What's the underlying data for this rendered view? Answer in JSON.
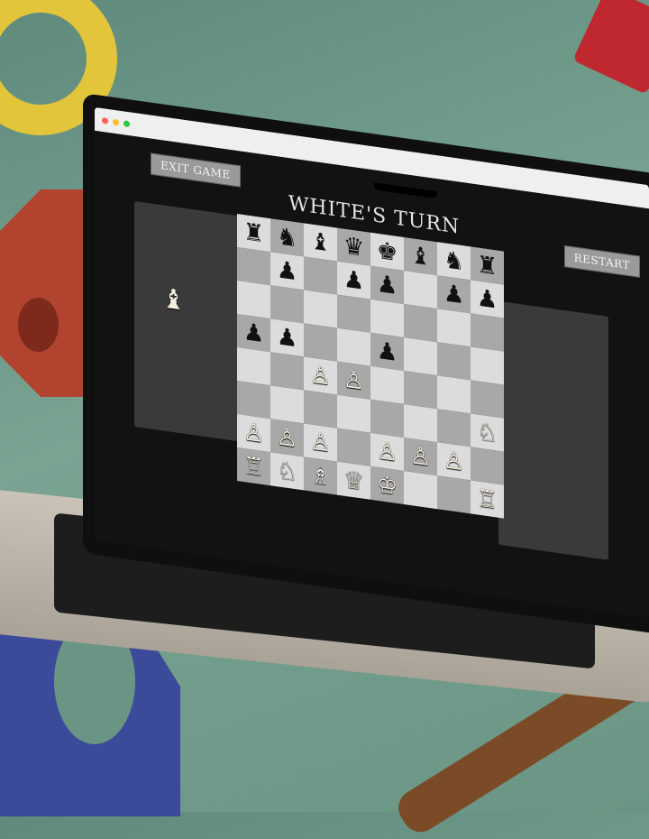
{
  "window": {
    "exit_label": "EXIT GAME",
    "restart_label": "RESTART",
    "turn_text": "WHITE'S TURN"
  },
  "captured_white": [
    "♝"
  ],
  "board": [
    [
      "♜",
      "♞",
      "♝",
      "♛",
      "♚",
      "♝",
      "♞",
      "♜"
    ],
    [
      "",
      "♟",
      "",
      "♟",
      "♟",
      "",
      "♟",
      "♟"
    ],
    [
      "",
      "",
      "",
      "",
      "",
      "",
      "",
      ""
    ],
    [
      "♟",
      "♟",
      "",
      "",
      "♟",
      "",
      "",
      ""
    ],
    [
      "",
      "",
      "♙",
      "♙",
      "",
      "",
      "",
      ""
    ],
    [
      "",
      "",
      "",
      "",
      "",
      "",
      "",
      "♘"
    ],
    [
      "♙",
      "♙",
      "♙",
      "",
      "♙",
      "♙",
      "♙",
      ""
    ],
    [
      "♖",
      "♘",
      "♗",
      "♕",
      "♔",
      "",
      "",
      "♖"
    ]
  ],
  "board_colors": {
    "white": [
      "♙",
      "♘",
      "♗",
      "♖",
      "♕",
      "♔"
    ]
  }
}
